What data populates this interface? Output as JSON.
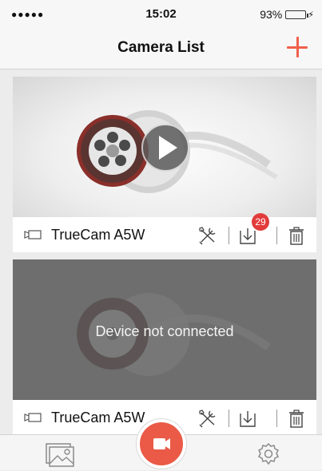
{
  "status_bar": {
    "signal": "●●●●●",
    "time": "15:02",
    "battery": "93%",
    "battery_level": 0.93,
    "battery_color": "#39c33a"
  },
  "nav": {
    "title": "Camera List",
    "add_icon": "plus-icon",
    "accent_color": "#f0604b"
  },
  "cameras": [
    {
      "name": "TrueCam A5W",
      "status": "connected",
      "download_badge": "29",
      "icons": [
        "video-camera-icon",
        "tools-icon",
        "download-icon",
        "trash-icon"
      ]
    },
    {
      "name": "TrueCam A5W",
      "status_text": "Device not connected",
      "icons": [
        "video-camera-icon",
        "tools-icon",
        "download-icon",
        "trash-icon"
      ]
    }
  ],
  "tab_bar": {
    "left_icon": "gallery-icon",
    "center_icon": "record-video-icon",
    "right_icon": "settings-gear-icon",
    "center_color": "#ea5a47"
  }
}
